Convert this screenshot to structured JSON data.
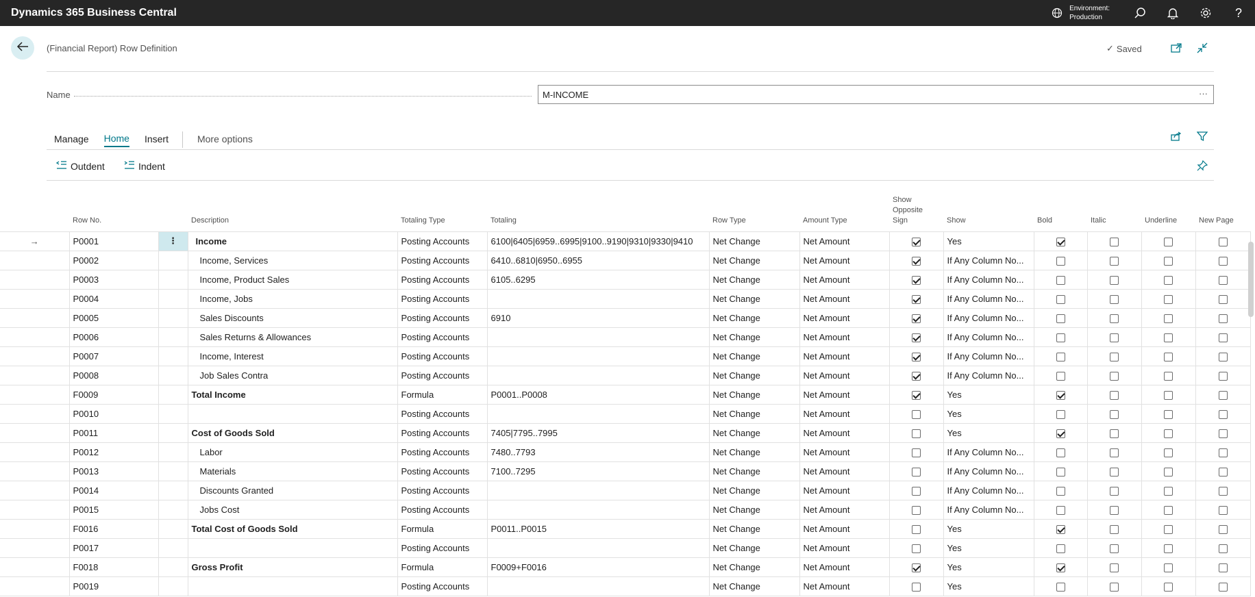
{
  "app": {
    "title": "Dynamics 365 Business Central",
    "environment_label": "Environment:",
    "environment_value": "Production",
    "help_label": "?"
  },
  "page": {
    "caption": "(Financial Report) Row Definition",
    "saved_label": "Saved",
    "name_label": "Name",
    "name_value": "M-INCOME",
    "name_ellipsis": "···"
  },
  "tabs": {
    "manage": "Manage",
    "home": "Home",
    "insert": "Insert",
    "more": "More options"
  },
  "actions": {
    "outdent": "Outdent",
    "indent": "Indent"
  },
  "columns": {
    "row_no": "Row No.",
    "description": "Description",
    "totaling_type": "Totaling Type",
    "totaling": "Totaling",
    "row_type": "Row Type",
    "amount_type": "Amount Type",
    "show_opposite_sign_1": "Show",
    "show_opposite_sign_2": "Opposite",
    "show_opposite_sign_3": "Sign",
    "show": "Show",
    "bold": "Bold",
    "italic": "Italic",
    "underline": "Underline",
    "new_page": "New Page"
  },
  "rows": [
    {
      "no": "P0001",
      "desc": "Income",
      "style": "bold-indent",
      "ttype": "Posting Accounts",
      "totaling": "6100|6405|6959..6995|9100..9190|9310|9330|9410",
      "rtype": "Net Change",
      "atype": "Net Amount",
      "opp": true,
      "show": "Yes",
      "bold": true,
      "italic": false,
      "underline": false,
      "newpage": false,
      "selected": true
    },
    {
      "no": "P0002",
      "desc": "Income, Services",
      "style": "indent",
      "ttype": "Posting Accounts",
      "totaling": "6410..6810|6950..6955",
      "rtype": "Net Change",
      "atype": "Net Amount",
      "opp": true,
      "show": "If Any Column No...",
      "bold": false,
      "italic": false,
      "underline": false,
      "newpage": false
    },
    {
      "no": "P0003",
      "desc": "Income, Product Sales",
      "style": "indent",
      "ttype": "Posting Accounts",
      "totaling": "6105..6295",
      "rtype": "Net Change",
      "atype": "Net Amount",
      "opp": true,
      "show": "If Any Column No...",
      "bold": false,
      "italic": false,
      "underline": false,
      "newpage": false
    },
    {
      "no": "P0004",
      "desc": "Income, Jobs",
      "style": "indent",
      "ttype": "Posting Accounts",
      "totaling": "",
      "rtype": "Net Change",
      "atype": "Net Amount",
      "opp": true,
      "show": "If Any Column No...",
      "bold": false,
      "italic": false,
      "underline": false,
      "newpage": false
    },
    {
      "no": "P0005",
      "desc": "Sales Discounts",
      "style": "indent",
      "ttype": "Posting Accounts",
      "totaling": "6910",
      "rtype": "Net Change",
      "atype": "Net Amount",
      "opp": true,
      "show": "If Any Column No...",
      "bold": false,
      "italic": false,
      "underline": false,
      "newpage": false
    },
    {
      "no": "P0006",
      "desc": "Sales Returns & Allowances",
      "style": "indent",
      "ttype": "Posting Accounts",
      "totaling": "",
      "rtype": "Net Change",
      "atype": "Net Amount",
      "opp": true,
      "show": "If Any Column No...",
      "bold": false,
      "italic": false,
      "underline": false,
      "newpage": false
    },
    {
      "no": "P0007",
      "desc": "Income, Interest",
      "style": "indent",
      "ttype": "Posting Accounts",
      "totaling": "",
      "rtype": "Net Change",
      "atype": "Net Amount",
      "opp": true,
      "show": "If Any Column No...",
      "bold": false,
      "italic": false,
      "underline": false,
      "newpage": false
    },
    {
      "no": "P0008",
      "desc": "Job Sales Contra",
      "style": "indent",
      "ttype": "Posting Accounts",
      "totaling": "",
      "rtype": "Net Change",
      "atype": "Net Amount",
      "opp": true,
      "show": "If Any Column No...",
      "bold": false,
      "italic": false,
      "underline": false,
      "newpage": false
    },
    {
      "no": "F0009",
      "desc": "Total Income",
      "style": "bold",
      "ttype": "Formula",
      "totaling": "P0001..P0008",
      "rtype": "Net Change",
      "atype": "Net Amount",
      "opp": true,
      "show": "Yes",
      "bold": true,
      "italic": false,
      "underline": false,
      "newpage": false
    },
    {
      "no": "P0010",
      "desc": "",
      "style": "plain",
      "ttype": "Posting Accounts",
      "totaling": "",
      "rtype": "Net Change",
      "atype": "Net Amount",
      "opp": false,
      "show": "Yes",
      "bold": false,
      "italic": false,
      "underline": false,
      "newpage": false
    },
    {
      "no": "P0011",
      "desc": "Cost of Goods Sold",
      "style": "bold",
      "ttype": "Posting Accounts",
      "totaling": "7405|7795..7995",
      "rtype": "Net Change",
      "atype": "Net Amount",
      "opp": false,
      "show": "Yes",
      "bold": true,
      "italic": false,
      "underline": false,
      "newpage": false
    },
    {
      "no": "P0012",
      "desc": "Labor",
      "style": "indent",
      "ttype": "Posting Accounts",
      "totaling": "7480..7793",
      "rtype": "Net Change",
      "atype": "Net Amount",
      "opp": false,
      "show": "If Any Column No...",
      "bold": false,
      "italic": false,
      "underline": false,
      "newpage": false
    },
    {
      "no": "P0013",
      "desc": "Materials",
      "style": "indent",
      "ttype": "Posting Accounts",
      "totaling": "7100..7295",
      "rtype": "Net Change",
      "atype": "Net Amount",
      "opp": false,
      "show": "If Any Column No...",
      "bold": false,
      "italic": false,
      "underline": false,
      "newpage": false
    },
    {
      "no": "P0014",
      "desc": "Discounts Granted",
      "style": "indent",
      "ttype": "Posting Accounts",
      "totaling": "",
      "rtype": "Net Change",
      "atype": "Net Amount",
      "opp": false,
      "show": "If Any Column No...",
      "bold": false,
      "italic": false,
      "underline": false,
      "newpage": false
    },
    {
      "no": "P0015",
      "desc": "Jobs Cost",
      "style": "indent",
      "ttype": "Posting Accounts",
      "totaling": "",
      "rtype": "Net Change",
      "atype": "Net Amount",
      "opp": false,
      "show": "If Any Column No...",
      "bold": false,
      "italic": false,
      "underline": false,
      "newpage": false
    },
    {
      "no": "F0016",
      "desc": "Total Cost of Goods Sold",
      "style": "bold",
      "ttype": "Formula",
      "totaling": "P0011..P0015",
      "rtype": "Net Change",
      "atype": "Net Amount",
      "opp": false,
      "show": "Yes",
      "bold": true,
      "italic": false,
      "underline": false,
      "newpage": false
    },
    {
      "no": "P0017",
      "desc": "",
      "style": "plain",
      "ttype": "Posting Accounts",
      "totaling": "",
      "rtype": "Net Change",
      "atype": "Net Amount",
      "opp": false,
      "show": "Yes",
      "bold": false,
      "italic": false,
      "underline": false,
      "newpage": false
    },
    {
      "no": "F0018",
      "desc": "Gross Profit",
      "style": "bold",
      "ttype": "Formula",
      "totaling": "F0009+F0016",
      "rtype": "Net Change",
      "atype": "Net Amount",
      "opp": true,
      "show": "Yes",
      "bold": true,
      "italic": false,
      "underline": false,
      "newpage": false
    },
    {
      "no": "P0019",
      "desc": "",
      "style": "plain",
      "ttype": "Posting Accounts",
      "totaling": "",
      "rtype": "Net Change",
      "atype": "Net Amount",
      "opp": false,
      "show": "Yes",
      "bold": false,
      "italic": false,
      "underline": false,
      "newpage": false
    }
  ],
  "icons": {
    "environment": "globe-icon",
    "search": "search-icon",
    "notifications": "bell-icon",
    "settings": "gear-icon",
    "back": "arrow-left-icon",
    "open_new_window": "open-in-new-window-icon",
    "collapse": "collapse-icon",
    "share": "share-icon",
    "filter": "filter-icon",
    "pin": "pin-icon",
    "row_menu": "more-vertical-icon",
    "current_row": "arrow-right-icon"
  },
  "colors": {
    "topbar": "#262626",
    "accent": "#00788a",
    "selected_cell": "#cfe9ee",
    "back_button": "#d9eef2"
  }
}
